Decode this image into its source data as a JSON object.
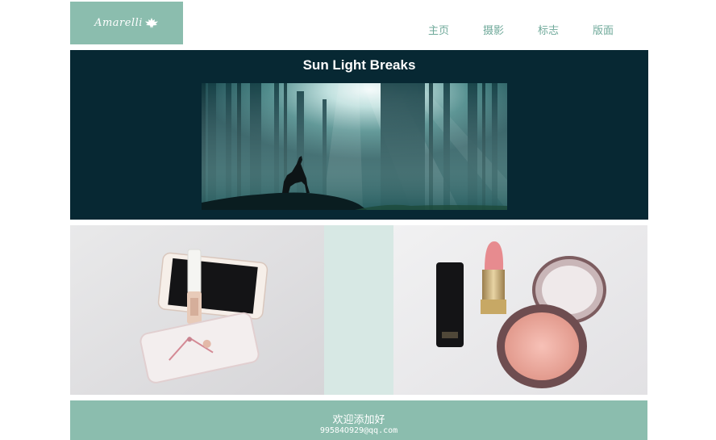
{
  "logo": {
    "text": "Amarelli",
    "icon": "maple-leaf-icon"
  },
  "nav": {
    "items": [
      {
        "label": "主页"
      },
      {
        "label": "摄影"
      },
      {
        "label": "标志"
      },
      {
        "label": "版面"
      }
    ]
  },
  "hero": {
    "title": "Sun Light Breaks",
    "image": "forest-wolf-photo"
  },
  "gallery": {
    "left_image": "phone-lipgloss-photo",
    "right_image": "lipstick-blush-photo"
  },
  "footer": {
    "line1": "欢迎添加好",
    "line2": "99584O929@qq.com"
  },
  "colors": {
    "accent": "#8bbdae",
    "hero_bg": "#072833",
    "nav_text": "#6fa99a",
    "gallery_bg": "#d7e8e4"
  }
}
